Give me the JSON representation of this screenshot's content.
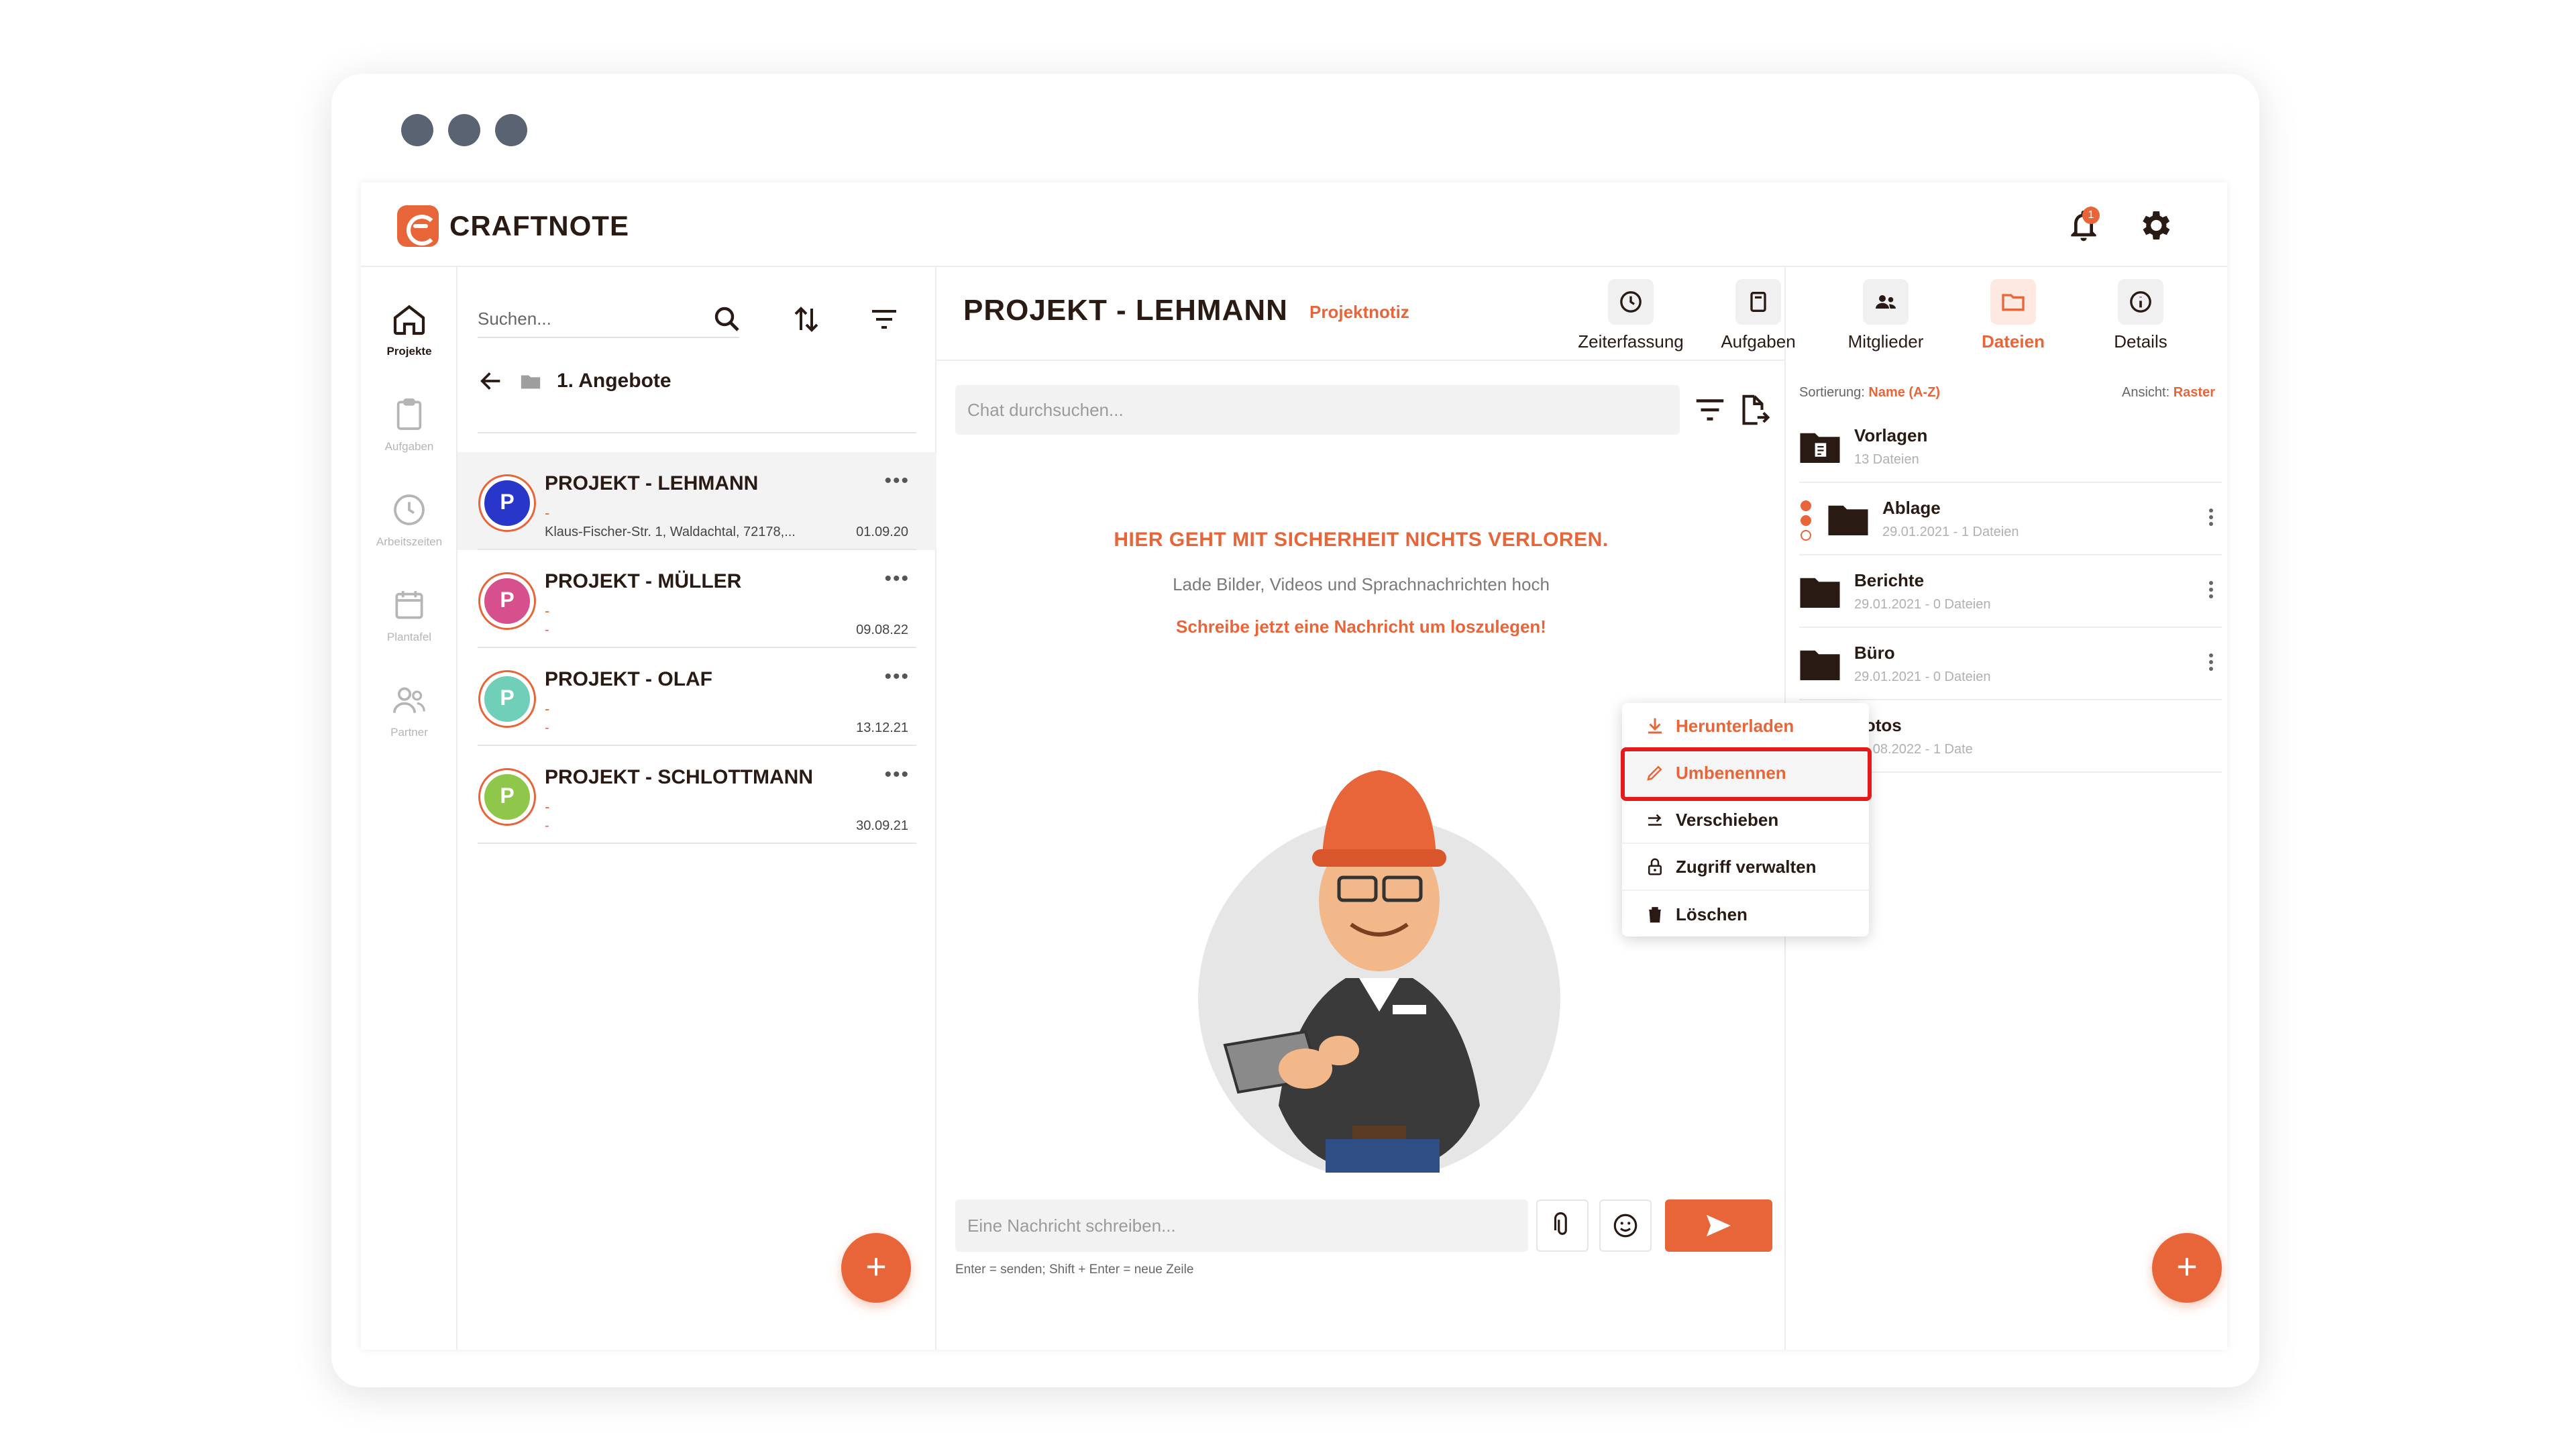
{
  "app": {
    "name": "CRAFTNOTE",
    "accent": "#e8653a",
    "notification_count": "1"
  },
  "rail": {
    "items": [
      {
        "label": "Projekte",
        "icon": "home-icon",
        "active": true
      },
      {
        "label": "Aufgaben",
        "icon": "clipboard-icon",
        "active": false
      },
      {
        "label": "Arbeitszeiten",
        "icon": "clock-icon",
        "active": false
      },
      {
        "label": "Plantafel",
        "icon": "calendar-icon",
        "active": false
      },
      {
        "label": "Partner",
        "icon": "people-icon",
        "active": false
      }
    ]
  },
  "project_list": {
    "search_placeholder": "Suchen...",
    "breadcrumb": "1. Angebote",
    "projects": [
      {
        "initial": "P",
        "name": "PROJEKT - LEHMANN",
        "line1": "-",
        "address": "Klaus-Fischer-Str. 1, Waldachtal, 72178,...",
        "date": "01.09.20",
        "color": "#2836c9"
      },
      {
        "initial": "P",
        "name": "PROJEKT - MÜLLER",
        "line1": "-",
        "address": "-",
        "date": "09.08.22",
        "color": "#d5508c"
      },
      {
        "initial": "P",
        "name": "PROJEKT - OLAF",
        "line1": "-",
        "address": "-",
        "date": "13.12.21",
        "color": "#6fcfb8"
      },
      {
        "initial": "P",
        "name": "PROJEKT - SCHLOTTMANN",
        "line1": "-",
        "address": "-",
        "date": "30.09.21",
        "color": "#8fc74b"
      }
    ],
    "fab": "+"
  },
  "chat": {
    "title": "PROJEKT - LEHMANN",
    "note": "Projektnotiz",
    "tabs": [
      {
        "label": "Zeiterfassung",
        "icon": "clock-icon"
      },
      {
        "label": "Aufgaben",
        "icon": "task-icon"
      },
      {
        "label": "Mitglieder",
        "icon": "members-icon"
      },
      {
        "label": "Dateien",
        "icon": "folder-icon",
        "active": true
      },
      {
        "label": "Details",
        "icon": "info-icon"
      }
    ],
    "search_placeholder": "Chat durchsuchen...",
    "empty_heading": "HIER GEHT MIT SICHERHEIT NICHTS VERLOREN.",
    "empty_sub": "Lade Bilder, Videos und Sprachnachrichten hoch",
    "empty_cta": "Schreibe jetzt eine Nachricht um loszulegen!",
    "message_placeholder": "Eine Nachricht schreiben...",
    "hint": "Enter = senden; Shift + Enter = neue Zeile"
  },
  "files": {
    "sort_label": "Sortierung:",
    "sort_value": "Name (A-Z)",
    "view_label": "Ansicht:",
    "view_value": "Raster",
    "items": [
      {
        "name": "Vorlagen",
        "meta": "13 Dateien"
      },
      {
        "name": "Ablage",
        "meta": "29.01.2021 - 1 Dateien"
      },
      {
        "name": "Berichte",
        "meta": "29.01.2021 - 0 Dateien"
      },
      {
        "name": "Büro",
        "meta": "29.01.2021 - 0 Dateien"
      },
      {
        "name": "Fotos",
        "meta": "17.08.2022 - 1 Date"
      }
    ],
    "fab": "+"
  },
  "context_menu": {
    "items": [
      {
        "label": "Herunterladen",
        "icon": "download-icon"
      },
      {
        "label": "Umbenennen",
        "icon": "pencil-icon"
      },
      {
        "label": "Verschieben",
        "icon": "move-icon"
      },
      {
        "label": "Zugriff verwalten",
        "icon": "lock-icon"
      },
      {
        "label": "Löschen",
        "icon": "trash-icon"
      }
    ]
  }
}
